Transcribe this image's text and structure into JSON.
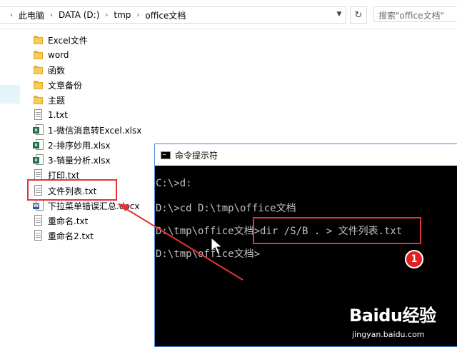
{
  "explorer": {
    "breadcrumbs": [
      "此电脑",
      "DATA (D:)",
      "tmp",
      "office文档"
    ],
    "search_placeholder": "搜索\"office文档\"",
    "files": [
      {
        "name": "Excel文件",
        "type": "folder"
      },
      {
        "name": "word",
        "type": "folder"
      },
      {
        "name": "函数",
        "type": "folder"
      },
      {
        "name": "文章备份",
        "type": "folder"
      },
      {
        "name": "主题",
        "type": "folder"
      },
      {
        "name": "1.txt",
        "type": "txt"
      },
      {
        "name": "1-微信消息转Excel.xlsx",
        "type": "xlsx"
      },
      {
        "name": "2-排序妙用.xlsx",
        "type": "xlsx"
      },
      {
        "name": "3-销量分析.xlsx",
        "type": "xlsx"
      },
      {
        "name": "打印.txt",
        "type": "txt"
      },
      {
        "name": "文件列表.txt",
        "type": "txt"
      },
      {
        "name": "下拉菜单错误汇总.docx",
        "type": "docx"
      },
      {
        "name": "重命名.txt",
        "type": "txt"
      },
      {
        "name": "重命名2.txt",
        "type": "txt"
      }
    ]
  },
  "cmd": {
    "title": "命令提示符",
    "lines": [
      "C:\\>d:",
      "D:\\>cd D:\\tmp\\office文档",
      "D:\\tmp\\office文档>dir /S/B . > 文件列表.txt",
      "D:\\tmp\\office文档>"
    ]
  },
  "annotation": {
    "step_number": "1"
  },
  "watermark": {
    "logo": "Baidu经验",
    "url": "jingyan.baidu.com"
  },
  "colors": {
    "highlight": "#e53333",
    "cmd_bg": "#000000",
    "cmd_text": "#c0c0c0",
    "folder": "#f6cd55"
  }
}
